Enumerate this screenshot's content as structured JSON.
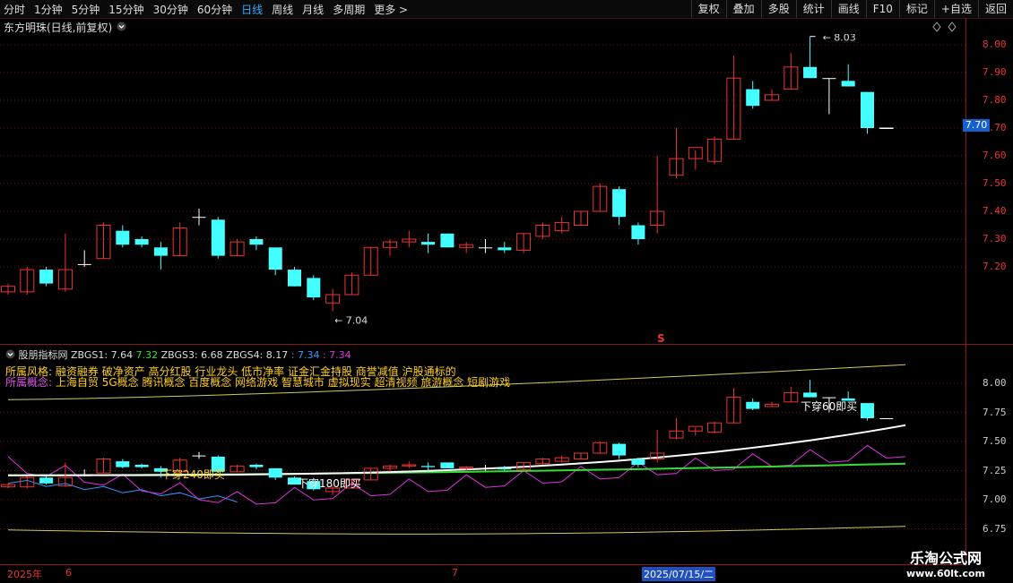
{
  "toolbar": {
    "periods": [
      "分时",
      "1分钟",
      "5分钟",
      "15分钟",
      "30分钟",
      "60分钟",
      "日线",
      "周线",
      "月线",
      "多周期",
      "更多"
    ],
    "active_period": "日线",
    "actions": [
      "复权",
      "叠加",
      "多股",
      "统计",
      "画线",
      "F10",
      "标记",
      "+自选",
      "返回"
    ]
  },
  "main": {
    "title": "东方明珠(日线,前复权)",
    "high_label": "8.03",
    "low_label": "7.04",
    "y_ticks": [
      "8.00",
      "7.90",
      "7.80",
      "7.70",
      "7.60",
      "7.50",
      "7.40",
      "7.30",
      "7.20"
    ],
    "current_price": "7.70",
    "signal_mark": "S"
  },
  "indicator": {
    "name": "股朋指标网",
    "values": [
      {
        "label": "ZBGS1: 7.64",
        "color": "#dddddd"
      },
      {
        "label": "7.32",
        "color": "#33dd33"
      },
      {
        "label": "ZBGS3: 6.68",
        "color": "#dddddd"
      },
      {
        "label": "ZBGS4: 8.17",
        "color": "#dddddd"
      },
      {
        "label": ": 7.34",
        "color": "#3399ff"
      },
      {
        "label": ": 7.34",
        "color": "#dd33dd"
      }
    ],
    "style_label": "所属风格:",
    "style_text": "融资融券 破净资产 高分红股 行业龙头 低市净率 证金汇金持股 商誉减值 沪股通标的",
    "concept_label": "所属概念:",
    "concept_text": "上海自贸 5G概念 腾讯概念 百度概念 网络游戏 智慧城市 虚拟现实 超清视频 旅游概念 短剧游戏",
    "y_ticks": [
      "8.00",
      "7.75",
      "7.50",
      "7.25",
      "7.00",
      "6.75"
    ],
    "annotations": [
      "下穿240即买",
      "下穿180即买",
      "下穿60即买"
    ]
  },
  "date_axis": {
    "labels": [
      "2025年",
      "6",
      "7"
    ],
    "highlight": "2025/07/15/二"
  },
  "watermark": {
    "line1": "乐淘公式网",
    "line2": "www.60lt.com"
  },
  "chart_data": {
    "type": "candlestick",
    "title": "东方明珠(日线,前复权)",
    "y_range": [
      7.04,
      8.08
    ],
    "candles": [
      {
        "o": 7.11,
        "h": 7.14,
        "l": 7.1,
        "c": 7.13
      },
      {
        "o": 7.11,
        "h": 7.2,
        "l": 7.1,
        "c": 7.19
      },
      {
        "o": 7.19,
        "h": 7.2,
        "l": 7.13,
        "c": 7.14
      },
      {
        "o": 7.12,
        "h": 7.32,
        "l": 7.11,
        "c": 7.19
      },
      {
        "o": 7.21,
        "h": 7.26,
        "l": 7.2,
        "c": 7.21
      },
      {
        "o": 7.23,
        "h": 7.36,
        "l": 7.23,
        "c": 7.35
      },
      {
        "o": 7.33,
        "h": 7.35,
        "l": 7.27,
        "c": 7.28
      },
      {
        "o": 7.3,
        "h": 7.31,
        "l": 7.27,
        "c": 7.28
      },
      {
        "o": 7.27,
        "h": 7.29,
        "l": 7.19,
        "c": 7.24
      },
      {
        "o": 7.24,
        "h": 7.36,
        "l": 7.24,
        "c": 7.34
      },
      {
        "o": 7.38,
        "h": 7.41,
        "l": 7.35,
        "c": 7.38
      },
      {
        "o": 7.37,
        "h": 7.38,
        "l": 7.23,
        "c": 7.24
      },
      {
        "o": 7.24,
        "h": 7.3,
        "l": 7.24,
        "c": 7.29
      },
      {
        "o": 7.3,
        "h": 7.31,
        "l": 7.26,
        "c": 7.28
      },
      {
        "o": 7.27,
        "h": 7.27,
        "l": 7.17,
        "c": 7.19
      },
      {
        "o": 7.19,
        "h": 7.2,
        "l": 7.13,
        "c": 7.13
      },
      {
        "o": 7.16,
        "h": 7.17,
        "l": 7.08,
        "c": 7.09
      },
      {
        "o": 7.07,
        "h": 7.12,
        "l": 7.04,
        "c": 7.1
      },
      {
        "o": 7.1,
        "h": 7.18,
        "l": 7.1,
        "c": 7.17
      },
      {
        "o": 7.17,
        "h": 7.27,
        "l": 7.17,
        "c": 7.27
      },
      {
        "o": 7.27,
        "h": 7.3,
        "l": 7.24,
        "c": 7.29
      },
      {
        "o": 7.29,
        "h": 7.33,
        "l": 7.27,
        "c": 7.3
      },
      {
        "o": 7.29,
        "h": 7.32,
        "l": 7.25,
        "c": 7.28
      },
      {
        "o": 7.32,
        "h": 7.32,
        "l": 7.27,
        "c": 7.27
      },
      {
        "o": 7.27,
        "h": 7.29,
        "l": 7.25,
        "c": 7.28
      },
      {
        "o": 7.27,
        "h": 7.3,
        "l": 7.25,
        "c": 7.27
      },
      {
        "o": 7.27,
        "h": 7.29,
        "l": 7.25,
        "c": 7.26
      },
      {
        "o": 7.26,
        "h": 7.32,
        "l": 7.25,
        "c": 7.32
      },
      {
        "o": 7.31,
        "h": 7.36,
        "l": 7.3,
        "c": 7.35
      },
      {
        "o": 7.33,
        "h": 7.38,
        "l": 7.32,
        "c": 7.36
      },
      {
        "o": 7.35,
        "h": 7.4,
        "l": 7.35,
        "c": 7.4
      },
      {
        "o": 7.4,
        "h": 7.5,
        "l": 7.4,
        "c": 7.49
      },
      {
        "o": 7.48,
        "h": 7.49,
        "l": 7.35,
        "c": 7.38
      },
      {
        "o": 7.35,
        "h": 7.36,
        "l": 7.28,
        "c": 7.3
      },
      {
        "o": 7.35,
        "h": 7.6,
        "l": 7.32,
        "c": 7.4
      },
      {
        "o": 7.53,
        "h": 7.7,
        "l": 7.52,
        "c": 7.59
      },
      {
        "o": 7.59,
        "h": 7.62,
        "l": 7.55,
        "c": 7.63
      },
      {
        "o": 7.58,
        "h": 7.67,
        "l": 7.57,
        "c": 7.66
      },
      {
        "o": 7.66,
        "h": 7.96,
        "l": 7.66,
        "c": 7.88
      },
      {
        "o": 7.84,
        "h": 7.87,
        "l": 7.77,
        "c": 7.78
      },
      {
        "o": 7.8,
        "h": 7.84,
        "l": 7.8,
        "c": 7.82
      },
      {
        "o": 7.84,
        "h": 7.97,
        "l": 7.84,
        "c": 7.92
      },
      {
        "o": 7.92,
        "h": 8.03,
        "l": 7.88,
        "c": 7.88
      },
      {
        "o": 7.88,
        "h": 7.88,
        "l": 7.75,
        "c": 7.88
      },
      {
        "o": 7.87,
        "h": 7.93,
        "l": 7.85,
        "c": 7.85
      },
      {
        "o": 7.83,
        "h": 7.83,
        "l": 7.68,
        "c": 7.7
      },
      {
        "o": 7.7,
        "h": 7.7,
        "l": 7.7,
        "c": 7.7
      }
    ],
    "indicator_range": [
      6.72,
      8.22
    ]
  }
}
